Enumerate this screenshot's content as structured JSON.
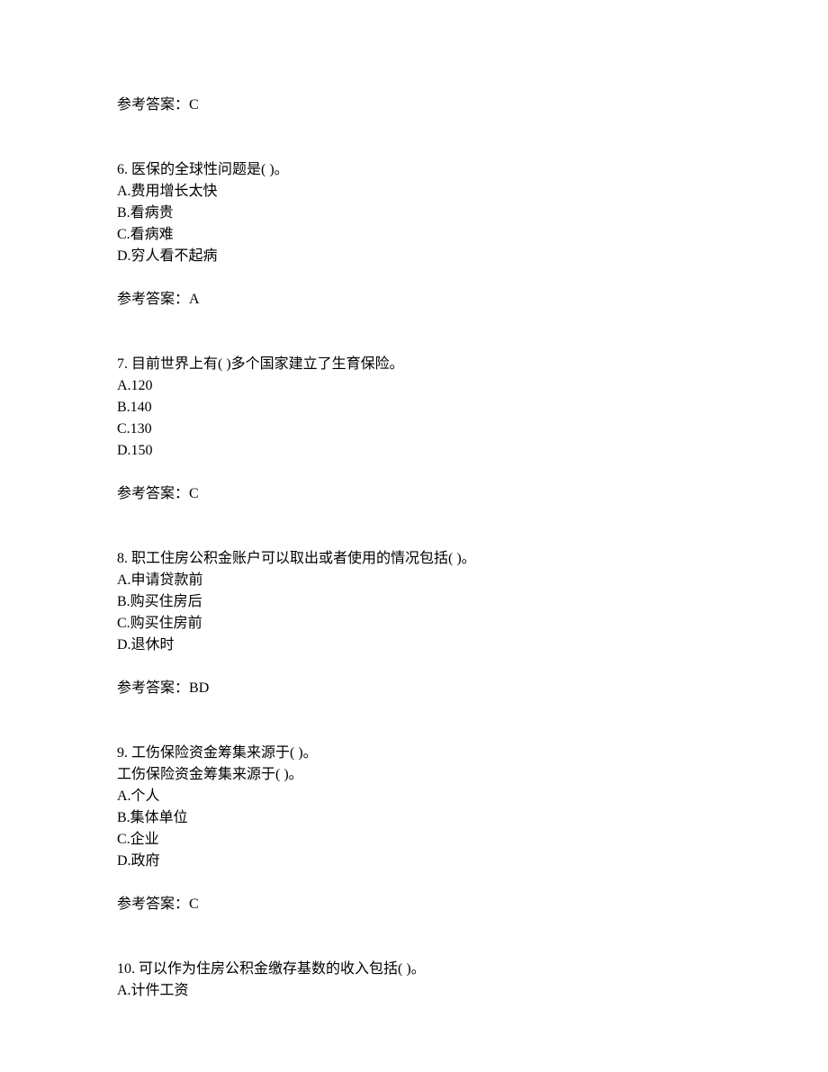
{
  "answer_label": "参考答案：",
  "top_answer": "C",
  "questions": [
    {
      "number": "6. ",
      "stem": "医保的全球性问题是(  )。",
      "options": [
        "A.费用增长太快",
        "B.看病贵",
        "C.看病难",
        "D.穷人看不起病"
      ],
      "answer": "A"
    },
    {
      "number": "7. ",
      "stem": "目前世界上有(  )多个国家建立了生育保险。",
      "options": [
        "A.120",
        "B.140",
        "C.130",
        "D.150"
      ],
      "answer": "C"
    },
    {
      "number": "8. ",
      "stem": "职工住房公积金账户可以取出或者使用的情况包括(  )。",
      "options": [
        "A.申请贷款前",
        "B.购买住房后",
        "C.购买住房前",
        "D.退休时"
      ],
      "answer": "BD"
    },
    {
      "number": "9. ",
      "stem": "工伤保险资金筹集来源于(  )。",
      "substem": "工伤保险资金筹集来源于(  )。",
      "options": [
        "A.个人",
        "B.集体单位",
        "C.企业",
        "D.政府"
      ],
      "answer": "C"
    },
    {
      "number": "10. ",
      "stem": "可以作为住房公积金缴存基数的收入包括(  )。",
      "options": [
        "A.计件工资"
      ]
    }
  ]
}
